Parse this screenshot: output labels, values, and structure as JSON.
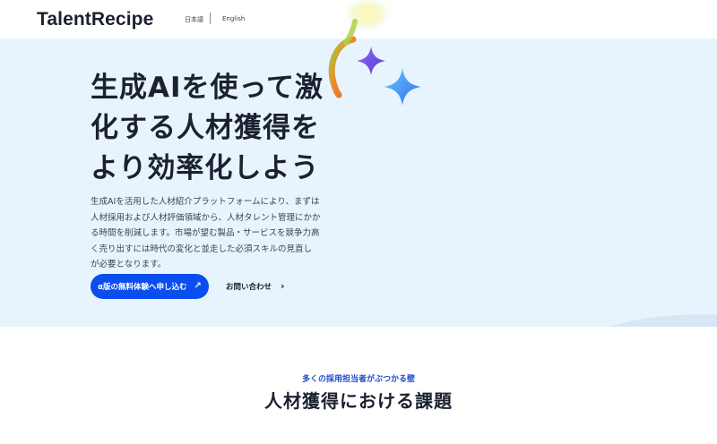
{
  "header": {
    "logo": "TalentRecipe",
    "lang_ja": "日本語",
    "lang_en": "English"
  },
  "hero": {
    "headline_lines": [
      "生成AIを使って激",
      "化する人材獲得を",
      "より効率化しよう"
    ],
    "description_lines": [
      "生成AIを活用した人材紹介プラットフォームにより、まずは",
      "人材採用および人材評価領域から、人材タレント管理にかか",
      "る時間を削減します。市場が望む製品・サービスを競争力高",
      "く売り出すには時代の変化と並走した必須スキルの見直し",
      "が必要となります。"
    ],
    "cta_label": "α版の無料体験へ申し込む",
    "cta_icon": "arrow-up-right-icon",
    "contact_label": "お問い合わせ",
    "contact_icon": "chevron-right-icon"
  },
  "section": {
    "eyebrow": "多くの採用担当者がぶつかる壁",
    "title": "人材獲得における課題"
  },
  "colors": {
    "accent": "#0a4ef0",
    "hero_bg": "#e8f4fd",
    "eyebrow": "#1f4ec9"
  }
}
